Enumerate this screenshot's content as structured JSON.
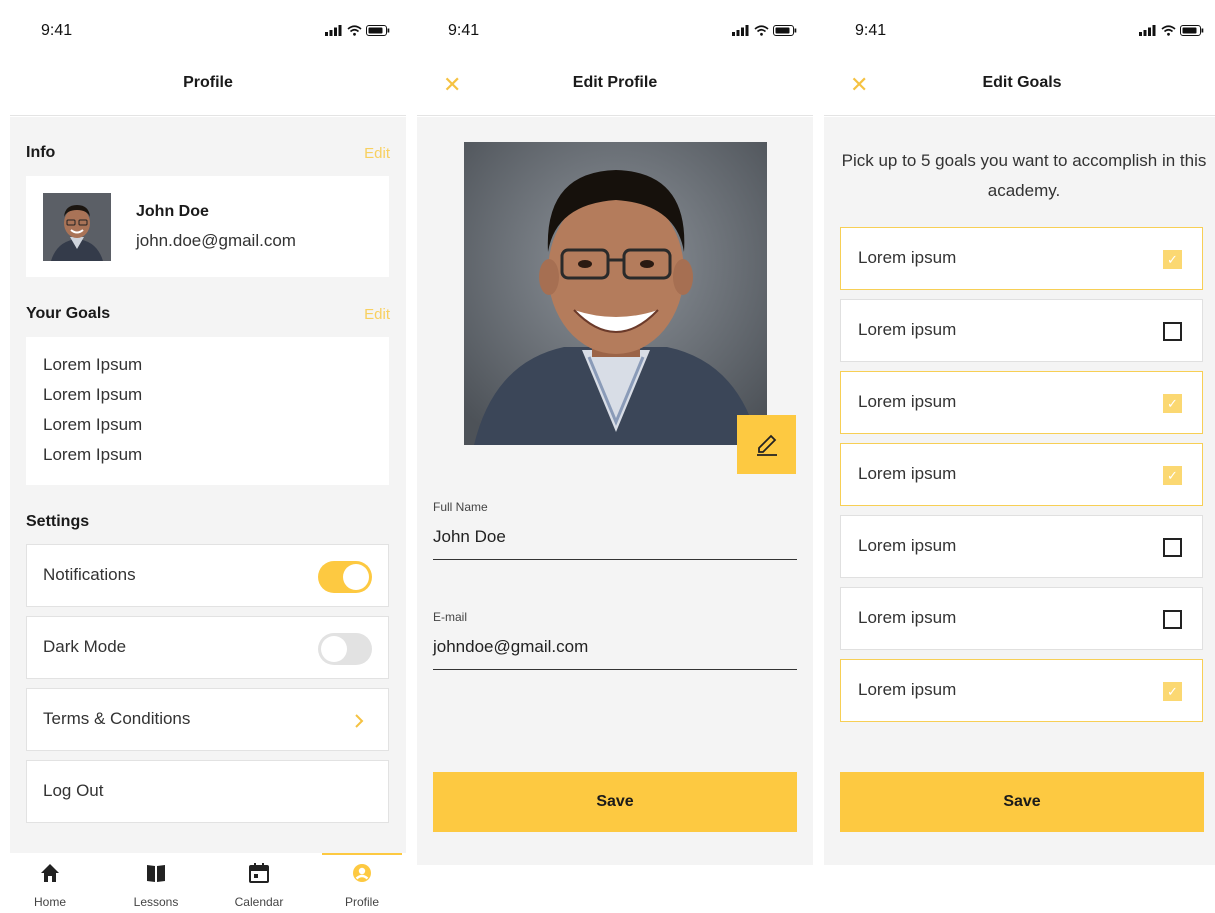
{
  "status": {
    "time": "9:41"
  },
  "profile": {
    "title": "Profile",
    "info_title": "Info",
    "info_edit": "Edit",
    "user_name": "John Doe",
    "user_email": "john.doe@gmail.com",
    "goals_title": "Your Goals",
    "goals_edit": "Edit",
    "goals": [
      "Lorem Ipsum",
      "Lorem Ipsum",
      "Lorem Ipsum",
      "Lorem Ipsum"
    ],
    "settings_title": "Settings",
    "settings": [
      {
        "label": "Notifications",
        "control": "toggle",
        "on": true
      },
      {
        "label": "Dark Mode",
        "control": "toggle",
        "on": false
      },
      {
        "label": "Terms & Conditions",
        "control": "chevron"
      },
      {
        "label": "Log Out",
        "control": "none"
      }
    ],
    "tabs": [
      {
        "label": "Home",
        "icon": "home-icon"
      },
      {
        "label": "Lessons",
        "icon": "book-icon"
      },
      {
        "label": "Calendar",
        "icon": "calendar-icon"
      },
      {
        "label": "Profile",
        "icon": "profile-icon",
        "active": true
      }
    ]
  },
  "edit_profile": {
    "title": "Edit Profile",
    "full_name_label": "Full Name",
    "full_name_value": "John Doe",
    "email_label": "E-mail",
    "email_value": "johndoe@gmail.com",
    "save_label": "Save"
  },
  "edit_goals": {
    "title": "Edit Goals",
    "instructions": "Pick up to 5 goals you want to accomplish in this academy.",
    "goals": [
      {
        "label": "Lorem ipsum",
        "checked": true
      },
      {
        "label": "Lorem ipsum",
        "checked": false
      },
      {
        "label": "Lorem ipsum",
        "checked": true
      },
      {
        "label": "Lorem ipsum",
        "checked": true
      },
      {
        "label": "Lorem ipsum",
        "checked": false
      },
      {
        "label": "Lorem ipsum",
        "checked": false
      },
      {
        "label": "Lorem ipsum",
        "checked": true
      }
    ],
    "save_label": "Save"
  },
  "colors": {
    "accent": "#fdc941",
    "edit_link": "#f8d060",
    "background": "#f4f4f4"
  }
}
